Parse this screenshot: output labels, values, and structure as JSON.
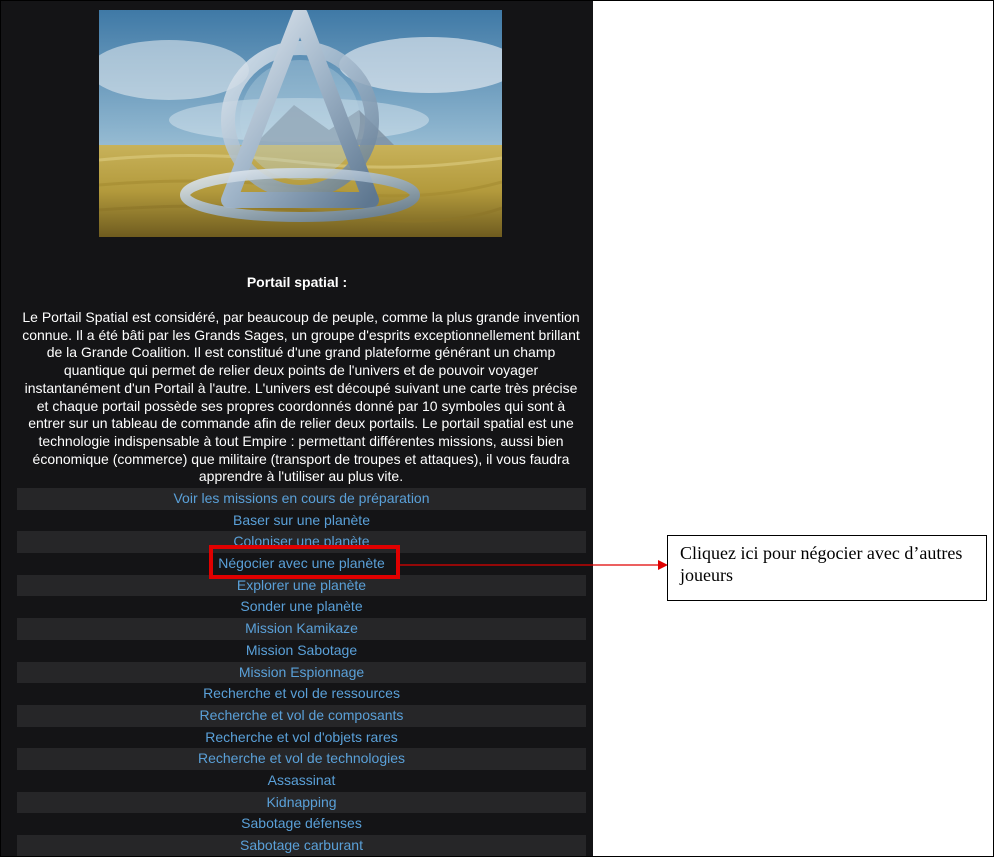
{
  "panel": {
    "title": "Portail spatial :",
    "description": "Le Portail Spatial est considéré, par beaucoup de peuple, comme la plus grande invention connue. Il a été bâti par les Grands Sages, un groupe d'esprits exceptionnellement brillant de la Grande Coalition. Il est constitué d'une grand plateforme générant un champ quantique qui permet de relier deux points de l'univers et de pouvoir voyager instantanément d'un Portail à l'autre. L'univers est découpé suivant une carte très précise et chaque portail possède ses propres coordonnés donné par 10 symboles qui sont à entrer sur un tableau de commande afin de relier deux portails. Le portail spatial est une technologie indispensable à tout Empire : permettant différentes missions, aussi bien économique (commerce) que militaire (transport de troupes et attaques), il vous faudra apprendre à l'utiliser au plus vite.",
    "missions": [
      "Voir les missions en cours de préparation",
      "Baser sur une planète",
      "Coloniser une planète",
      "Négocier avec une planète",
      "Explorer une planète",
      "Sonder une planète",
      "Mission Kamikaze",
      "Mission Sabotage",
      "Mission Espionnage",
      "Recherche et vol de ressources",
      "Recherche et vol de composants",
      "Recherche et vol d'objets rares",
      "Recherche et vol de technologies",
      "Assassinat",
      "Kidnapping",
      "Sabotage défenses",
      "Sabotage carburant"
    ],
    "highlighted_mission_index": 3
  },
  "callout": {
    "text": "Cliquez ici pour négocier avec d’autres joueurs"
  },
  "colors": {
    "panel_background": "#141416",
    "row_alternate": "#262628",
    "link": "#5aa0d8",
    "highlight": "#e00000"
  },
  "icons": {
    "banner": "portal-illustration"
  }
}
